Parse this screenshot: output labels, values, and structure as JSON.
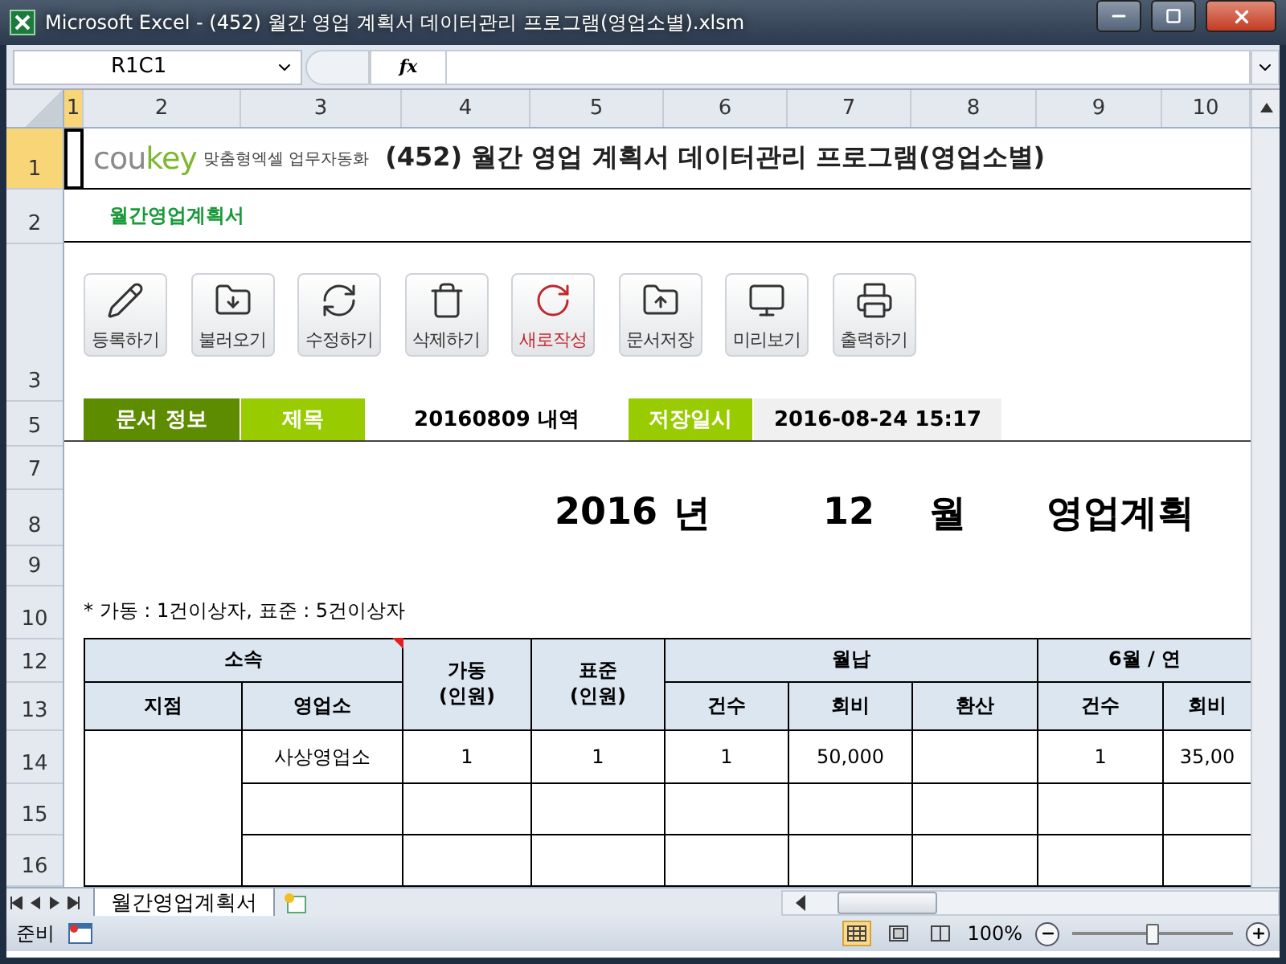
{
  "window": {
    "title": "Microsoft Excel - (452) 월간 영업 계획서 데이터관리 프로그램(영업소별).xlsm"
  },
  "formula_bar": {
    "name_box": "R1C1",
    "fx": "fx"
  },
  "column_headers": [
    {
      "label": "1",
      "selected": true
    },
    {
      "label": "2",
      "selected": false
    },
    {
      "label": "3",
      "selected": false
    },
    {
      "label": "4",
      "selected": false
    },
    {
      "label": "5",
      "selected": false
    },
    {
      "label": "6",
      "selected": false
    },
    {
      "label": "7",
      "selected": false
    },
    {
      "label": "8",
      "selected": false
    },
    {
      "label": "9",
      "selected": false
    },
    {
      "label": "10",
      "selected": false
    }
  ],
  "row_headers": [
    {
      "label": "1",
      "selected": true
    },
    {
      "label": "2",
      "selected": false
    },
    {
      "label": "3",
      "selected": false
    },
    {
      "label": "5",
      "selected": false
    },
    {
      "label": "7",
      "selected": false
    },
    {
      "label": "8",
      "selected": false
    },
    {
      "label": "9",
      "selected": false
    },
    {
      "label": "10",
      "selected": false
    },
    {
      "label": "12",
      "selected": false
    },
    {
      "label": "13",
      "selected": false
    },
    {
      "label": "14",
      "selected": false
    },
    {
      "label": "15",
      "selected": false
    },
    {
      "label": "16",
      "selected": false
    }
  ],
  "logo": {
    "brand": [
      {
        "text": "cou",
        "color": "#8a8a8a"
      },
      {
        "text": "key",
        "color": "#7cb82f"
      }
    ],
    "tagline": "맞춤형엑셀 업무자동화"
  },
  "sheet_title": "(452) 월간 영업 계획서 데이터관리 프로그램(영업소별)",
  "section_label": "월간영업계획서",
  "toolbar": [
    {
      "label": "등록하기",
      "kind": "pencil",
      "color": "#333333"
    },
    {
      "label": "불러오기",
      "kind": "folder-down",
      "color": "#333333"
    },
    {
      "label": "수정하기",
      "kind": "refresh",
      "color": "#333333"
    },
    {
      "label": "삭제하기",
      "kind": "trash",
      "color": "#333333"
    },
    {
      "label": "새로작성",
      "kind": "rotate",
      "color": "#c0282d"
    },
    {
      "label": "문서저장",
      "kind": "folder-up",
      "color": "#333333"
    },
    {
      "label": "미리보기",
      "kind": "monitor",
      "color": "#333333"
    },
    {
      "label": "출력하기",
      "kind": "printer",
      "color": "#333333"
    }
  ],
  "info_bar": [
    {
      "text": "문서 정보",
      "kind": "label-dark"
    },
    {
      "text": "제목",
      "kind": "label"
    },
    {
      "text": "20160809 내역",
      "kind": "value"
    },
    {
      "text": "저장일시",
      "kind": "label"
    },
    {
      "text": "2016-08-24 15:17",
      "kind": "value-shaded"
    }
  ],
  "heading": {
    "year": "2016",
    "year_unit": "년",
    "month": "12",
    "month_unit": "월",
    "title": "영업계획"
  },
  "note": "* 가동 : 1건이상자, 표준 : 5건이상자",
  "table": {
    "groups": [
      {
        "label": "소속",
        "columns": [
          "지점",
          "영업소"
        ],
        "comment": true
      },
      {
        "label": "가동\n(인원)"
      },
      {
        "label": "표준\n(인원)"
      },
      {
        "label": "월납",
        "columns": [
          "건수",
          "회비",
          "환산"
        ]
      },
      {
        "label": "6월 / 연",
        "columns": [
          "건수",
          "회비"
        ]
      }
    ],
    "rows": [
      {
        "cells": [
          "사상영업소",
          "1",
          "1",
          "1",
          "50,000",
          null,
          "1",
          "35,00"
        ]
      },
      {
        "cells": [
          null,
          null,
          null,
          null,
          null,
          null,
          null,
          null
        ]
      },
      {
        "cells": [
          null,
          null,
          null,
          null,
          null,
          null,
          null,
          null
        ]
      }
    ]
  },
  "sheet_tabs": [
    {
      "label": "월간영업계획서",
      "selected": true
    }
  ],
  "status_bar": {
    "text": "준비",
    "zoom": "100%",
    "zoom_slider": {
      "level": 0.5
    },
    "views": [
      {
        "kind": "normal",
        "selected": true
      },
      {
        "kind": "layout",
        "selected": false
      },
      {
        "kind": "break",
        "selected": false
      }
    ]
  }
}
